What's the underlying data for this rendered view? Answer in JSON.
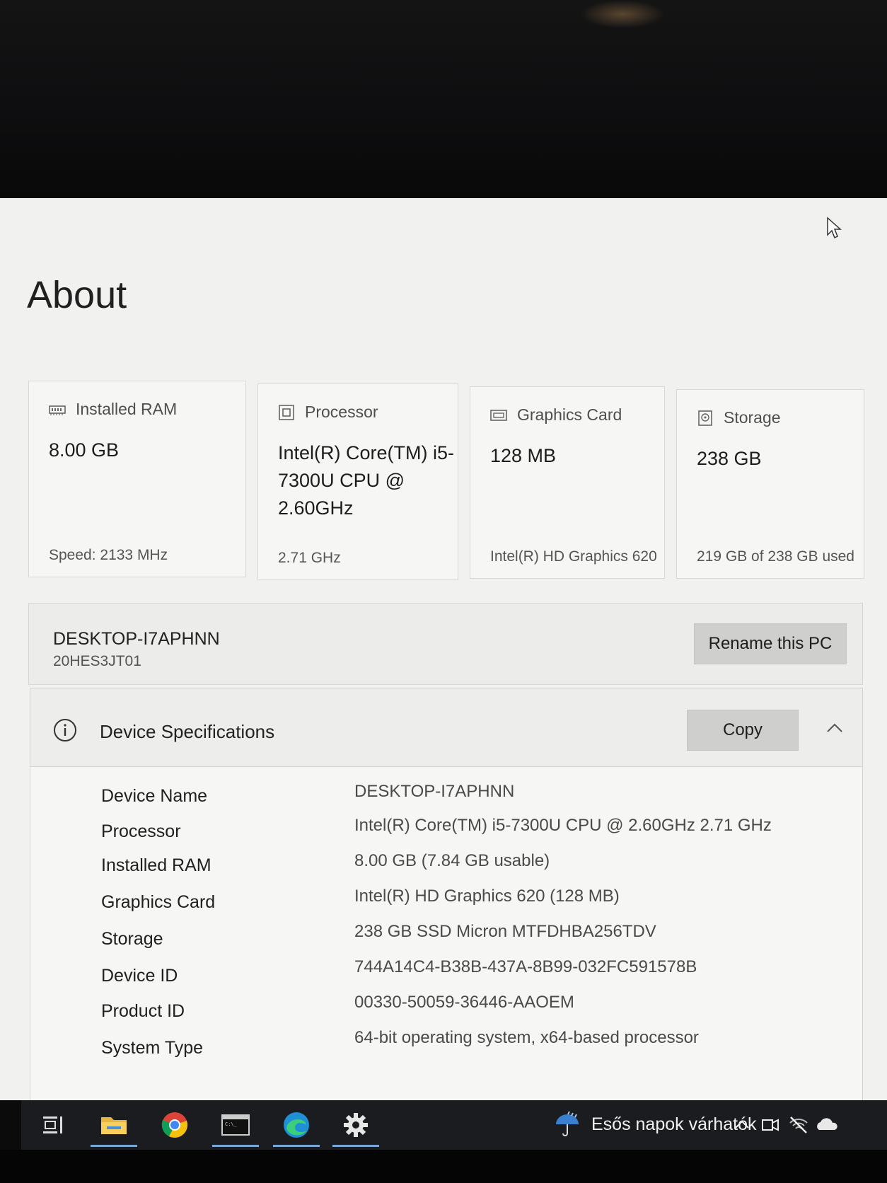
{
  "page": {
    "title": "About",
    "cards": [
      {
        "label": "Installed RAM",
        "icon": "ram-icon",
        "value": "8.00 GB",
        "footer": "Speed: 2133 MHz"
      },
      {
        "label": "Processor",
        "icon": "processor-icon",
        "value": "Intel(R) Core(TM) i5-7300U CPU @ 2.60GHz",
        "footer": "2.71 GHz"
      },
      {
        "label": "Graphics Card",
        "icon": "graphics-card-icon",
        "value": "128 MB",
        "footer": "Intel(R) HD Graphics 620"
      },
      {
        "label": "Storage",
        "icon": "storage-icon",
        "value": "238 GB",
        "footer": "219 GB of 238 GB used"
      }
    ],
    "pc": {
      "name": "DESKTOP-I7APHNN",
      "model": "20HES3JT01",
      "rename_label": "Rename this PC"
    },
    "specs": {
      "title": "Device Specifications",
      "copy_label": "Copy",
      "rows": [
        {
          "key": "Device Name",
          "value": "DESKTOP-I7APHNN"
        },
        {
          "key": "Processor",
          "value": "Intel(R) Core(TM) i5-7300U CPU @ 2.60GHz   2.71 GHz"
        },
        {
          "key": "Installed RAM",
          "value": "8.00 GB (7.84 GB usable)"
        },
        {
          "key": "Graphics Card",
          "value": "Intel(R) HD Graphics 620 (128 MB)"
        },
        {
          "key": "Storage",
          "value": "238 GB SSD Micron MTFDHBA256TDV"
        },
        {
          "key": "Device ID",
          "value": "744A14C4-B38B-437A-8B99-032FC591578B"
        },
        {
          "key": "Product ID",
          "value": "00330-50059-36446-AAOEM"
        },
        {
          "key": "System Type",
          "value": "64-bit operating system, x64-based processor"
        }
      ]
    }
  },
  "taskbar": {
    "apps": [
      "task-view-icon",
      "file-explorer-icon",
      "chrome-icon",
      "terminal-icon",
      "edge-icon",
      "settings-icon"
    ],
    "weather_text": "Esős napok várhatók",
    "tray_icons": [
      "chevron-up-icon",
      "meet-now-icon",
      "network-off-icon",
      "onedrive-icon"
    ]
  }
}
